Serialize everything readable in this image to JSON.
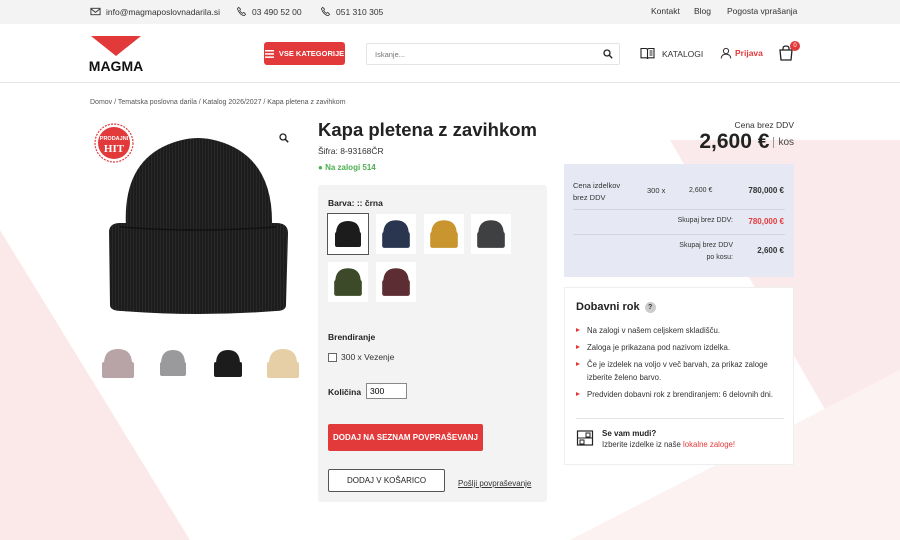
{
  "topbar": {
    "email": "info@magmaposlovnadarila.si",
    "phone1": "03 490 52 00",
    "phone2": "051 310 305",
    "links": [
      "Kontakt",
      "Blog",
      "Pogosta vprašanja"
    ]
  },
  "header": {
    "logo_text": "MAGMA",
    "categories_label": "VSE KATEGORIJE",
    "search_placeholder": "Iskanje...",
    "catalogs_label": "KATALOGI",
    "login_label": "Prijava",
    "cart_count": "0"
  },
  "breadcrumb": "Domov / Tematska poslovna darila / Katalog 2026/2027 / Kapa pletena z zavihkom",
  "gallery": {
    "badge_line1": "PRODAJNI",
    "badge_line2": "HIT",
    "thumbnails": [
      {
        "color": "#b8a3a6"
      },
      {
        "color": "#9a9a9c"
      },
      {
        "color": "#1c1c1c"
      },
      {
        "color": "#e6cfa7"
      }
    ]
  },
  "product": {
    "title": "Kapa pletena z zavihkom",
    "sku": "Šifra: 8-93168ČR",
    "stock": "Na zalogi 514",
    "price_label": "Cena brez DDV",
    "price": "2,600 €",
    "unit": "kos"
  },
  "options": {
    "color_label": "Barva: :: črna",
    "swatches": [
      {
        "name": "črna",
        "color": "#1c1c1c",
        "selected": true
      },
      {
        "name": "modra",
        "color": "#2a3650",
        "selected": false
      },
      {
        "name": "gorčična",
        "color": "#c8952f",
        "selected": false
      },
      {
        "name": "siva",
        "color": "#3e4042",
        "selected": false
      },
      {
        "name": "olivna",
        "color": "#3c4a2a",
        "selected": false
      },
      {
        "name": "bordo",
        "color": "#5c2d33",
        "selected": false
      }
    ],
    "branding_label": "Brendiranje",
    "branding_option": "300 x Vezenje",
    "qty_label": "Količina",
    "qty_value": "300",
    "add_to_inquiry": "DODAJ NA SEZNAM POVPRAŠEVANJ",
    "add_to_cart": "DODAJ V KOŠARICO",
    "send_inquiry": "Pošlji povpraševanje"
  },
  "pricing": {
    "row_label": "Cena izdelkov brez DDV",
    "row_qty": "300 x",
    "row_unit_price": "2,600 €",
    "row_total": "780,000 €",
    "subtotal_label": "Skupaj brez DDV:",
    "subtotal_value": "780,000 €",
    "per_piece_label": "Skupaj brez DDV po kosu:",
    "per_piece_value": "2,600 €"
  },
  "delivery": {
    "title": "Dobavni rok",
    "items": [
      "Na zalogi v našem celjskem skladišču.",
      "Zaloga je prikazana pod nazivom izdelka.",
      "Če je izdelek na voljo v več barvah, za prikaz zaloge izberite želeno barvo.",
      "Predviden dobavni rok z brendiranjem: 6 delovnih dni."
    ],
    "help_title": "Se vam mudi?",
    "help_text": "Izberite izdelke iz naše",
    "help_link": "lokalne zaloge!"
  }
}
